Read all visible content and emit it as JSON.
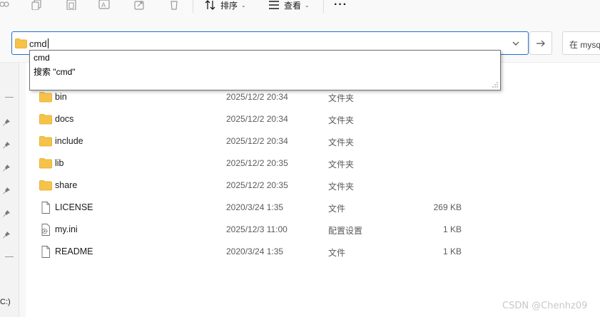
{
  "toolbar": {
    "icons": [
      "cut-icon",
      "copy-icon",
      "paste-icon",
      "rename-icon",
      "share-icon",
      "delete-icon"
    ],
    "sort_label": "排序",
    "view_label": "查看",
    "more_label": "···"
  },
  "address": {
    "value": "cmd",
    "search_placeholder": "在 mysq"
  },
  "suggestions": [
    {
      "label": "cmd"
    },
    {
      "label": "搜索 \"cmd\""
    }
  ],
  "nav": {
    "drive_label": "C:)"
  },
  "files": [
    {
      "name": "bin",
      "date": "2025/12/2 20:34",
      "type": "文件夹",
      "size": "",
      "icon": "folder-icon"
    },
    {
      "name": "docs",
      "date": "2025/12/2 20:34",
      "type": "文件夹",
      "size": "",
      "icon": "folder-icon"
    },
    {
      "name": "include",
      "date": "2025/12/2 20:34",
      "type": "文件夹",
      "size": "",
      "icon": "folder-icon"
    },
    {
      "name": "lib",
      "date": "2025/12/2 20:35",
      "type": "文件夹",
      "size": "",
      "icon": "folder-icon"
    },
    {
      "name": "share",
      "date": "2025/12/2 20:35",
      "type": "文件夹",
      "size": "",
      "icon": "folder-icon"
    },
    {
      "name": "LICENSE",
      "date": "2020/3/24 1:35",
      "type": "文件",
      "size": "269 KB",
      "icon": "file-icon"
    },
    {
      "name": "my.ini",
      "date": "2025/12/3 11:00",
      "type": "配置设置",
      "size": "1 KB",
      "icon": "settings-file-icon"
    },
    {
      "name": "README",
      "date": "2020/3/24 1:35",
      "type": "文件",
      "size": "1 KB",
      "icon": "file-icon"
    }
  ],
  "watermark": "CSDN @Chenhz09",
  "colors": {
    "accent": "#1e6ed3",
    "folder": "#f6c34a",
    "folder_dark": "#e3a921"
  }
}
